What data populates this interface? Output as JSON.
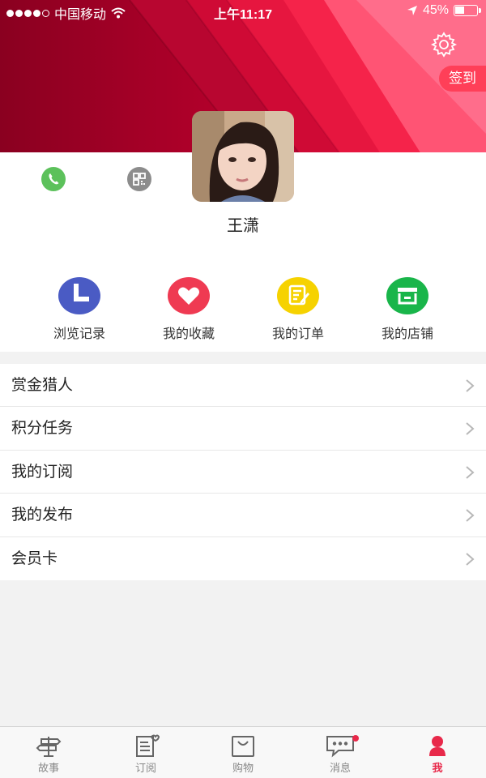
{
  "status_bar": {
    "carrier": "中国移动",
    "time": "上午11:17",
    "battery_percent_label": "45%",
    "battery_level": 0.45
  },
  "header": {
    "checkin_label": "签到",
    "username": "王潇",
    "colors": {
      "primary": "#e8294a",
      "dark_red": "#8e0022",
      "pink": "#ff6b8a"
    }
  },
  "quick_actions": [
    {
      "label": "浏览记录",
      "icon": "clock-icon",
      "color": "#4a5bc4"
    },
    {
      "label": "我的收藏",
      "icon": "heart-icon",
      "color": "#ef3a52"
    },
    {
      "label": "我的订单",
      "icon": "edit-document-icon",
      "color": "#f6d200"
    },
    {
      "label": "我的店铺",
      "icon": "store-icon",
      "color": "#19b54a"
    }
  ],
  "menu": {
    "items": [
      {
        "label": "赏金猎人"
      },
      {
        "label": "积分任务"
      },
      {
        "label": "我的订阅"
      },
      {
        "label": "我的发布"
      },
      {
        "label": "会员卡"
      }
    ]
  },
  "tabbar": {
    "tabs": [
      {
        "label": "故事",
        "icon": "signpost-icon"
      },
      {
        "label": "订阅",
        "icon": "subscribe-icon"
      },
      {
        "label": "购物",
        "icon": "shopping-bag-icon"
      },
      {
        "label": "消息",
        "icon": "chat-bubble-icon"
      },
      {
        "label": "我",
        "icon": "person-icon"
      }
    ],
    "active_index": 4
  }
}
